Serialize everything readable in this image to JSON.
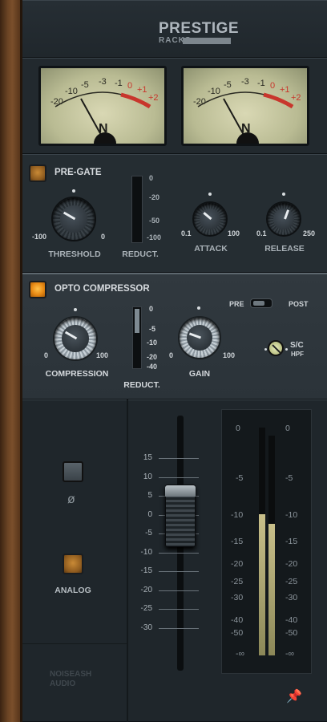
{
  "header": {
    "brand": "PRESTIGE",
    "sub": "RACKS"
  },
  "vu_scale": [
    "-20",
    "-10",
    "-5",
    "-3",
    "-1",
    "0",
    "+1",
    "+2"
  ],
  "vu_logo": "N",
  "pregate": {
    "title": "PRE-GATE",
    "threshold": {
      "label": "THRESHOLD",
      "min": "-100",
      "max": "0"
    },
    "reduction": {
      "label": "REDUCT.",
      "scale": [
        "0",
        "-20",
        "-50",
        "-100"
      ]
    },
    "attack": {
      "label": "ATTACK",
      "min": "0.1",
      "max": "100"
    },
    "release": {
      "label": "RELEASE",
      "min": "0.1",
      "max": "250"
    }
  },
  "opto": {
    "title": "OPTO COMPRESSOR",
    "compression": {
      "label": "COMPRESSION",
      "min": "0",
      "max": "100"
    },
    "reduction": {
      "label": "REDUCT.",
      "scale": [
        "0",
        "-5",
        "-10",
        "-20",
        "-40"
      ]
    },
    "gain": {
      "label": "GAIN",
      "min": "0",
      "max": "100"
    },
    "pre_label": "PRE",
    "post_label": "POST",
    "sc_hpf": {
      "line1": "S/C",
      "line2": "HPF"
    }
  },
  "bottom": {
    "phase_symbol": "ø",
    "analog_label": "ANALOG",
    "fader_scale": [
      "15",
      "10",
      "5",
      "0",
      "-5",
      "-10",
      "-15",
      "-20",
      "-25",
      "-30"
    ],
    "meter_scale": [
      "0",
      "-5",
      "-10",
      "-15",
      "-20",
      "-25",
      "-30",
      "-40",
      "-50",
      "-∞"
    ],
    "meter_level_left": 0.62,
    "meter_level_right": 0.6,
    "brand_line1": "NOISEASH",
    "brand_line2": "AUDIO",
    "pin_icon": "📌"
  }
}
